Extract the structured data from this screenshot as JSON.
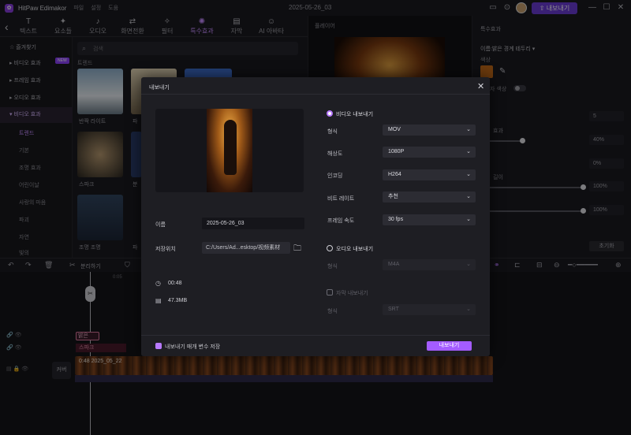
{
  "app": {
    "title": "HitPaw Edimakor",
    "menu": [
      "파일",
      "설정",
      "도움"
    ],
    "project_name": "2025-05-26_03",
    "export_label": "내보내기"
  },
  "tooltabs": [
    {
      "label": "텍스트",
      "icon": "T"
    },
    {
      "label": "요소들",
      "icon": "✦"
    },
    {
      "label": "오디오",
      "icon": "♪"
    },
    {
      "label": "화면전환",
      "icon": "⇄"
    },
    {
      "label": "필터",
      "icon": "✧"
    },
    {
      "label": "특수효과",
      "icon": "✺",
      "active": true
    },
    {
      "label": "자막",
      "icon": "▤"
    },
    {
      "label": "AI 아바타",
      "icon": "☺"
    }
  ],
  "sidebar": {
    "items": [
      {
        "label": "즐겨찾기"
      },
      {
        "label": "비디오 효과"
      },
      {
        "label": "프레임 효과"
      },
      {
        "label": "오디오 효과"
      },
      {
        "label": "비디오 효과",
        "active": true
      }
    ],
    "new_badge": "NEW",
    "subitems": [
      {
        "label": "트렌드",
        "active": true
      },
      {
        "label": "기본"
      },
      {
        "label": "조명 효과"
      },
      {
        "label": "어린이날"
      },
      {
        "label": "사랑의 마음"
      },
      {
        "label": "파괴"
      },
      {
        "label": "자연"
      },
      {
        "label": "빛의"
      }
    ]
  },
  "media": {
    "search_placeholder": "검색",
    "section": "트렌드",
    "thumbs": [
      {
        "label": "반짝 라이트"
      },
      {
        "label": "파"
      },
      {
        "label": "스파크"
      },
      {
        "label": "분"
      },
      {
        "label": "조명 조명"
      },
      {
        "label": "파"
      }
    ]
  },
  "player": {
    "label": "플레이어"
  },
  "rightpanel": {
    "tab": "특수효과",
    "name": "이름:밝은 경계 테두리 ▾",
    "color_label": "색상",
    "auto_label": "자 색상",
    "fields": [
      "5",
      "40%",
      "0%",
      "100%",
      "100%"
    ],
    "labels": [
      "효과",
      "길이"
    ],
    "reset": "초기화"
  },
  "timeline": {
    "ruler_label": "0:05",
    "split_label": "분리하기",
    "clip_title": "밝은",
    "clip_effect": "스파크",
    "cover_label": "커버",
    "video_label": "0:48 2025_05_22"
  },
  "dialog": {
    "title": "내보내기",
    "name_label": "이름",
    "name_value": "2025-05-26_03",
    "path_label": "저장위치",
    "path_value": "C:/Users/Ad...esktop/视频素材",
    "duration": "00:48",
    "size": "47.3MB",
    "video_export_label": "비디오 내보내기",
    "video_rows": [
      {
        "label": "형식",
        "value": "MOV"
      },
      {
        "label": "해상도",
        "value": "1080P"
      },
      {
        "label": "인코딩",
        "value": "H264"
      },
      {
        "label": "비트 레이트",
        "value": "추천"
      },
      {
        "label": "프레임 속도",
        "value": "30  fps"
      }
    ],
    "audio_export_label": "오디오 내보내기",
    "audio_row": {
      "label": "형식",
      "value": "M4A"
    },
    "subtitle_export_label": "자막 내보내기",
    "subtitle_row": {
      "label": "형식",
      "value": "SRT"
    },
    "remember_label": "내보내기 매개 변수 저장",
    "export_button": "내보내기"
  }
}
